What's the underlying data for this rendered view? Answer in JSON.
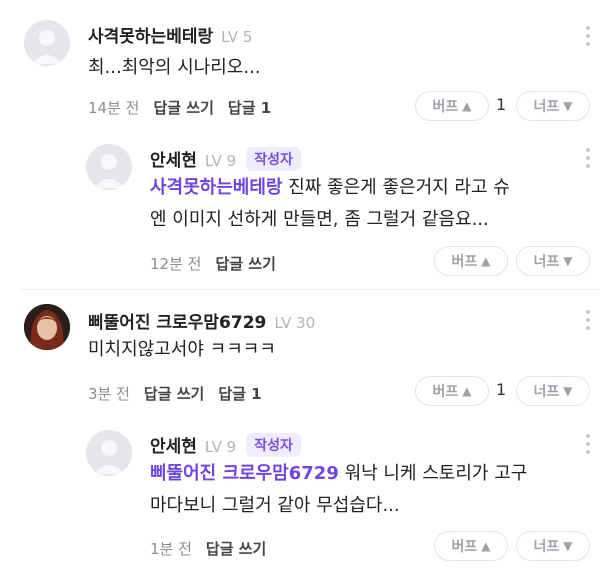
{
  "comments": [
    {
      "author": "사격못하는베테랑",
      "level": "LV 5",
      "text": "최...최악의 시나리오...",
      "time": "14분 전",
      "reply_label": "답글 쓰기",
      "replies_label": "답글 1",
      "upvote_label": "버프",
      "upvote_count": "1",
      "downvote_label": "너프"
    },
    {
      "author": "안세현",
      "level": "LV 9",
      "badge": "작성자",
      "mention": "사격못하는베테랑",
      "text_line1": " 진짜 좋은게 좋은거지 라고 슈",
      "text_line2": "엔 이미지 선하게 만들면, 좀 그럴거 같음요...",
      "time": "12분 전",
      "reply_label": "답글 쓰기",
      "upvote_label": "버프",
      "downvote_label": "너프"
    },
    {
      "author": "삐뚤어진 크로우맘6729",
      "level": "LV 30",
      "text": "미치지않고서야 ㅋㅋㅋㅋ",
      "time": "3분 전",
      "reply_label": "답글 쓰기",
      "replies_label": "답글 1",
      "upvote_label": "버프",
      "upvote_count": "1",
      "downvote_label": "너프"
    },
    {
      "author": "안세현",
      "level": "LV 9",
      "badge": "작성자",
      "mention": "삐뚤어진 크로우맘6729",
      "text_line1": " 워낙 니케 스토리가 고구",
      "text_line2": "마다보니 그럴거 같아 무섭습다...",
      "time": "1분 전",
      "reply_label": "답글 쓰기",
      "upvote_label": "버프",
      "downvote_label": "너프"
    }
  ],
  "icons": {
    "up_arrow": "arrow-up-icon",
    "down_arrow": "arrow-down-icon",
    "more": "more-vertical-icon"
  }
}
